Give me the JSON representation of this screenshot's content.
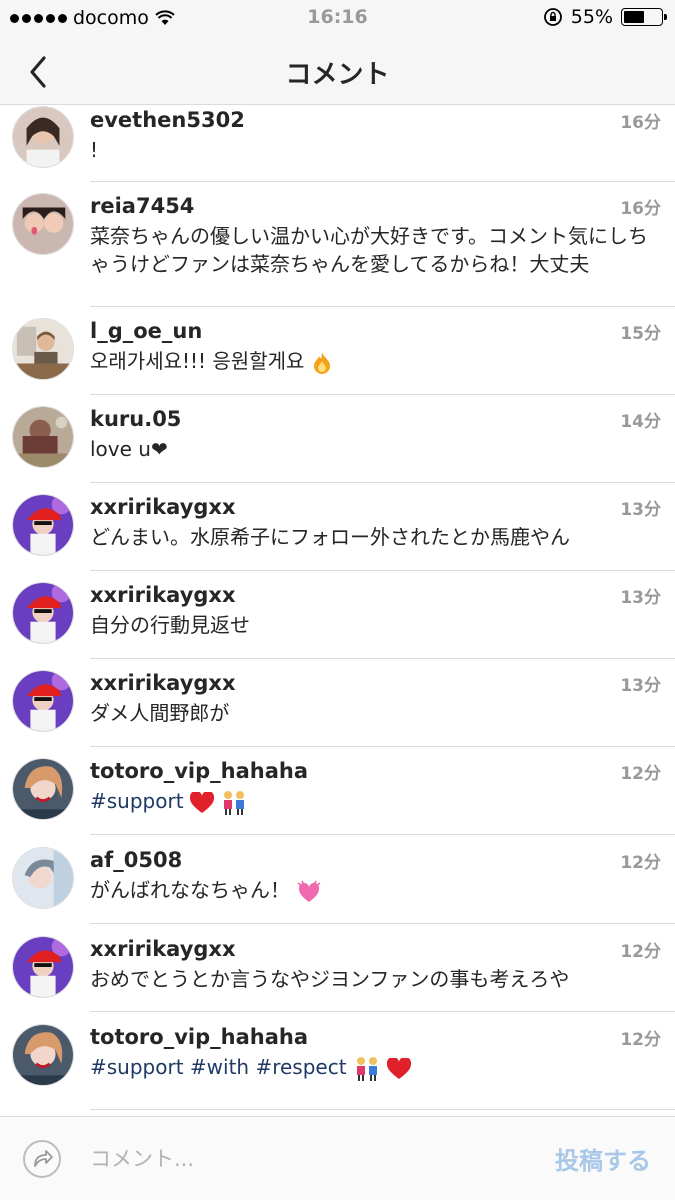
{
  "status": {
    "carrier": "docomo",
    "time": "16:16",
    "battery": "55%"
  },
  "nav": {
    "title": "コメント"
  },
  "comments": [
    {
      "username": "evethen5302",
      "text": "!",
      "time": "16分"
    },
    {
      "username": "reia7454",
      "text": "菜奈ちゃんの優しい温かい心が大好きです。コメント気にしちゃうけどファンは菜奈ちゃんを愛してるからね！大丈夫",
      "time": "16分"
    },
    {
      "username": "l_g_oe_un",
      "text": "오래가세요!!! 응원할게요",
      "time": "15分"
    },
    {
      "username": "kuru.05",
      "text": "love u❤",
      "time": "14分"
    },
    {
      "username": "xxririkaygxx",
      "text": "どんまい。水原希子にフォロー外されたとか馬鹿やん",
      "time": "13分"
    },
    {
      "username": "xxririkaygxx",
      "text": "自分の行動見返せ",
      "time": "13分"
    },
    {
      "username": "xxririkaygxx",
      "text": "ダメ人間野郎が",
      "time": "13分"
    },
    {
      "username": "totoro_vip_hahaha",
      "text": "#support",
      "time": "12分"
    },
    {
      "username": "af_0508",
      "text": "がんばれななちゃん！",
      "time": "12分"
    },
    {
      "username": "xxririkaygxx",
      "text": "おめでとうとか言うなやジヨンファンの事も考えろや",
      "time": "12分"
    },
    {
      "username": "totoro_vip_hahaha",
      "text": "#support #with #respect",
      "time": "12分"
    }
  ],
  "composer": {
    "placeholder": "コメント...",
    "post_label": "投稿する"
  },
  "icons": {
    "back": "chevron-left-icon",
    "share": "share-arrow-icon",
    "wifi": "wifi-icon",
    "lock": "rotation-lock-icon",
    "battery": "battery-icon"
  },
  "colors": {
    "hashtag": "#1f3a63",
    "post_disabled": "#a9c8e8",
    "separator": "#dbdbdb"
  }
}
